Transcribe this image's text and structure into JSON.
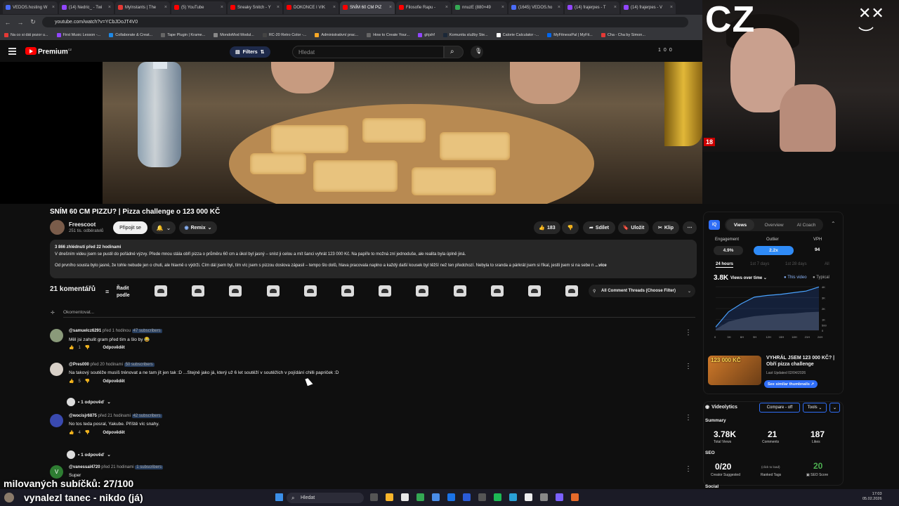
{
  "browser": {
    "tabs": [
      {
        "label": "VEDOS.hosting W",
        "color": "#4a6cf7"
      },
      {
        "label": "(14) Nedric_ - Twi",
        "color": "#9146ff"
      },
      {
        "label": "MyInstants | The",
        "color": "#e53935"
      },
      {
        "label": "(5) YouTube",
        "color": "#ff0000"
      },
      {
        "label": "Sneaky Snitch - Y",
        "color": "#ff0000"
      },
      {
        "label": "DOKONCE I VIK",
        "color": "#ff0000"
      },
      {
        "label": "SNÍM 60 CM PIZ",
        "color": "#ff0000",
        "active": true
      },
      {
        "label": "Filosofie Rapu -",
        "color": "#ff0000"
      },
      {
        "label": "nnuzE (880×49",
        "color": "#34a853"
      },
      {
        "label": "(1645) VEDOS.ho",
        "color": "#4a6cf7"
      },
      {
        "label": "(14) frajerpes - T",
        "color": "#9146ff"
      },
      {
        "label": "(14) frajerpes - V",
        "color": "#9146ff"
      }
    ],
    "url": "youtube.com/watch?v=YCbJDoJT4V0",
    "bookmarks": [
      {
        "label": "Na co si dát pozor u...",
        "color": "#e53935"
      },
      {
        "label": "First Music Lesson -...",
        "color": "#9146ff"
      },
      {
        "label": "Collaborate & Creat...",
        "color": "#1e88e5"
      },
      {
        "label": "Tape Plugin | Krame...",
        "color": "#666666"
      },
      {
        "label": "MondoMod Modul...",
        "color": "#888888"
      },
      {
        "label": "RC-20 Retro Color -...",
        "color": "#444444"
      },
      {
        "label": "Administrativní prac...",
        "color": "#f9a825"
      },
      {
        "label": "How to Create Your...",
        "color": "#666666"
      },
      {
        "label": "ghjshf",
        "color": "#9146ff"
      },
      {
        "label": "Komunita služby Ste...",
        "color": "#1b2838"
      },
      {
        "label": "Calorie Calculator -...",
        "color": "#ffffff"
      },
      {
        "label": "MyFitnessPal | MyFit...",
        "color": "#0066ee"
      },
      {
        "label": "Cha - Cha by Simon...",
        "color": "#e53935"
      }
    ]
  },
  "yt": {
    "logo": "Premium",
    "logo_sup": "CZ",
    "filters": "Filters",
    "search_placeholder": "Hledat",
    "counters": [
      "1",
      "0",
      "0"
    ]
  },
  "webcam": {
    "big_text": "CZ",
    "tag": "18"
  },
  "video": {
    "title": "SNÍM 60 CM PIZZU? | Pizza challenge o 123 000 KČ",
    "channel": "Freescoot",
    "subscribers": "251 tis. odběratelů",
    "subscribe": "Připojit se",
    "remix": "Remix",
    "likes": "183",
    "share": "Sdílet",
    "save": "Uložit",
    "clip": "Klip",
    "stats": "3 866 zhlédnutí  před 22 hodinami",
    "desc1": "V dnešním videu jsem se pustil do pořádné výzvy. Přede mnou stála obří pizza o průměru 60 cm a úkol byl jasný – sníst ji celou a mít šanci vyhrát 123 000 Kč. Na papíře to možná zní jednoduše, ale realita byla úplně jiná.",
    "desc2": "Od prvního sousta bylo jasné, že tohle nebude jen o chuti, ale hlavně o výdrži. Čím dál jsem byl, tím víc jsem s pizzou doslova zápasil – tempo šlo dolů, hlava pracovala naplno a každý další kousek byl těžší než ten předchozí. Nebyla to sranda a párkrát jsem si říkal, jestli jsem si na sebe n",
    "more": "...více"
  },
  "comments": {
    "count": "21 komentářů",
    "sort": "Řadit podle",
    "threads": "All Comment Threads (Choose Filter)",
    "add": "Okomentovat...",
    "reply_label": "Odpovědět",
    "items": [
      {
        "user": "@samuelcz6291",
        "time": "před 1 hodinou",
        "badge": "47 subscribers",
        "text": "Měl jsi zahulit  gram před tím a šlo by 😂",
        "likes": "1",
        "color": "#8a9a7a"
      },
      {
        "user": "@Pres000",
        "time": "před 20 hodinami",
        "badge": "50 subscribers",
        "text": "Na takový soutěže musíš trénovat a ne tam jít jen tak :D ...Stejně jako já, který už 6 let soutěží v soutěžích v pojídání chilli papriček :D",
        "likes": "5",
        "color": "#d8d0c8",
        "replies": "1 odpověď"
      },
      {
        "user": "@wocisjr6875",
        "time": "před 21 hodinami",
        "badge": "42 subscribers",
        "text": "No tos teda posral, Yakube. Příště víc snahy.",
        "likes": "4",
        "color": "#3a4ab0",
        "replies": "1 odpověď"
      },
      {
        "user": "@vanessal4720",
        "time": "před 21 hodinami",
        "badge": "1 subscribers",
        "text": "Super",
        "likes": "",
        "color": "#2e7d32",
        "initial": "V"
      }
    ]
  },
  "analytics": {
    "tabs": [
      "Views",
      "Overview",
      "AI Coach"
    ],
    "engagement_label": "Engagement",
    "engagement": "4.9%",
    "outlier_label": "Outlier",
    "outlier": "2.2x",
    "vph_label": "VPH",
    "vph": "94",
    "ranges": [
      "24 hours",
      "1st 7 days",
      "1st 28 days",
      "All"
    ],
    "views": "3.8K",
    "views_mode": "Views over time",
    "this_video": "This video",
    "typical": "Typical",
    "y_ticks": [
      "4K",
      "3K",
      "2K",
      "1K",
      "500",
      "0"
    ],
    "x_ticks": [
      "0",
      "3H",
      "6H",
      "9H",
      "12H",
      "15H",
      "18H",
      "21H",
      "24H"
    ],
    "related_title": "VYHRÁL JSEM 123 000 KČ? | Obří pizza challenge",
    "updated": "Last Updated 02/04/2026",
    "similar": "See similar thumbnails",
    "thumb_text": "123 000 KČ"
  },
  "chart_data": {
    "type": "line",
    "x": [
      "0",
      "3H",
      "6H",
      "9H",
      "12H",
      "15H",
      "18H",
      "21H",
      "24H"
    ],
    "series": [
      {
        "name": "This video",
        "values": [
          300,
          1700,
          2450,
          3050,
          3200,
          3300,
          3450,
          3600,
          3980
        ]
      },
      {
        "name": "Typical",
        "values": [
          100,
          800,
          1100,
          1300,
          1400,
          1500,
          1550,
          1650,
          1700
        ]
      }
    ],
    "ylim": [
      0,
      4000
    ]
  },
  "videolytics": {
    "title": "Videolytics",
    "compare": "Compare - off",
    "tools": "Tools",
    "summary": "Summary",
    "total_views": "3.78K",
    "total_views_label": "Total Views",
    "comments": "21",
    "comments_label": "Comments",
    "likes": "187",
    "likes_label": "Likes",
    "seo": "SEO",
    "creator_suggested": "0/20",
    "creator_suggested_label": "Creator Suggested",
    "ranked_tags_hint": "(click to load)",
    "ranked_tags_label": "Ranked Tags",
    "seo_score": "20",
    "seo_score_label": "SEO Score",
    "social": "Social"
  },
  "stream_overlay": {
    "line1": "milovaných subíčků: 27/100",
    "line2": "vynalezl tanec - nikdo (já)"
  },
  "taskbar": {
    "search": "Hledat",
    "time": "17:03",
    "date": "05.02.2026"
  }
}
